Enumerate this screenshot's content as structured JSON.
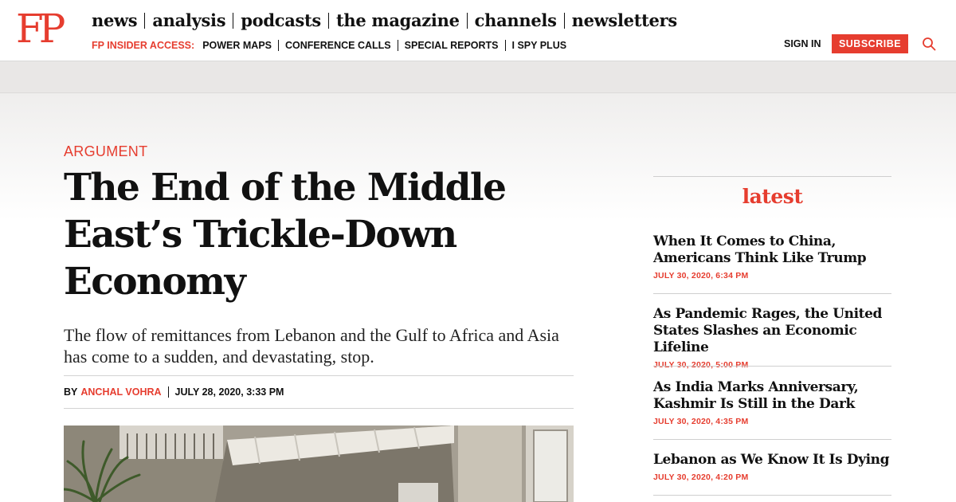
{
  "header": {
    "logo": "FP",
    "main_nav": [
      "news",
      "analysis",
      "podcasts",
      "the magazine",
      "channels",
      "newsletters"
    ],
    "insider_label": "FP INSIDER ACCESS:",
    "sub_nav": [
      "POWER MAPS",
      "CONFERENCE CALLS",
      "SPECIAL REPORTS",
      "I SPY PLUS"
    ],
    "sign_in": "SIGN IN",
    "subscribe": "SUBSCRIBE",
    "search_icon": "search-icon"
  },
  "article": {
    "kicker": "ARGUMENT",
    "headline": "The End of the Middle East’s Trickle-Down Economy",
    "dek": "The flow of remittances from Lebanon and the Gulf to Africa and Asia has come to a sudden, and devastating, stop.",
    "by_label": "BY",
    "author": "ANCHAL VOHRA",
    "date": "JULY 28, 2020, 3:33 PM"
  },
  "sidebar": {
    "heading": "latest",
    "stories": [
      {
        "title": "When It Comes to China, Americans Think Like Trump",
        "date": "JULY 30, 2020, 6:34 PM"
      },
      {
        "title": "As Pandemic Rages, the United States Slashes an Economic Lifeline",
        "date": "JULY 30, 2020, 5:00 PM"
      },
      {
        "title": "As India Marks Anniversary, Kashmir Is Still in the Dark",
        "date": "JULY 30, 2020, 4:35 PM"
      },
      {
        "title": "Lebanon as We Know It Is Dying",
        "date": "JULY 30, 2020, 4:20 PM"
      }
    ]
  },
  "colors": {
    "accent": "#e63d2f",
    "text": "#111111"
  }
}
